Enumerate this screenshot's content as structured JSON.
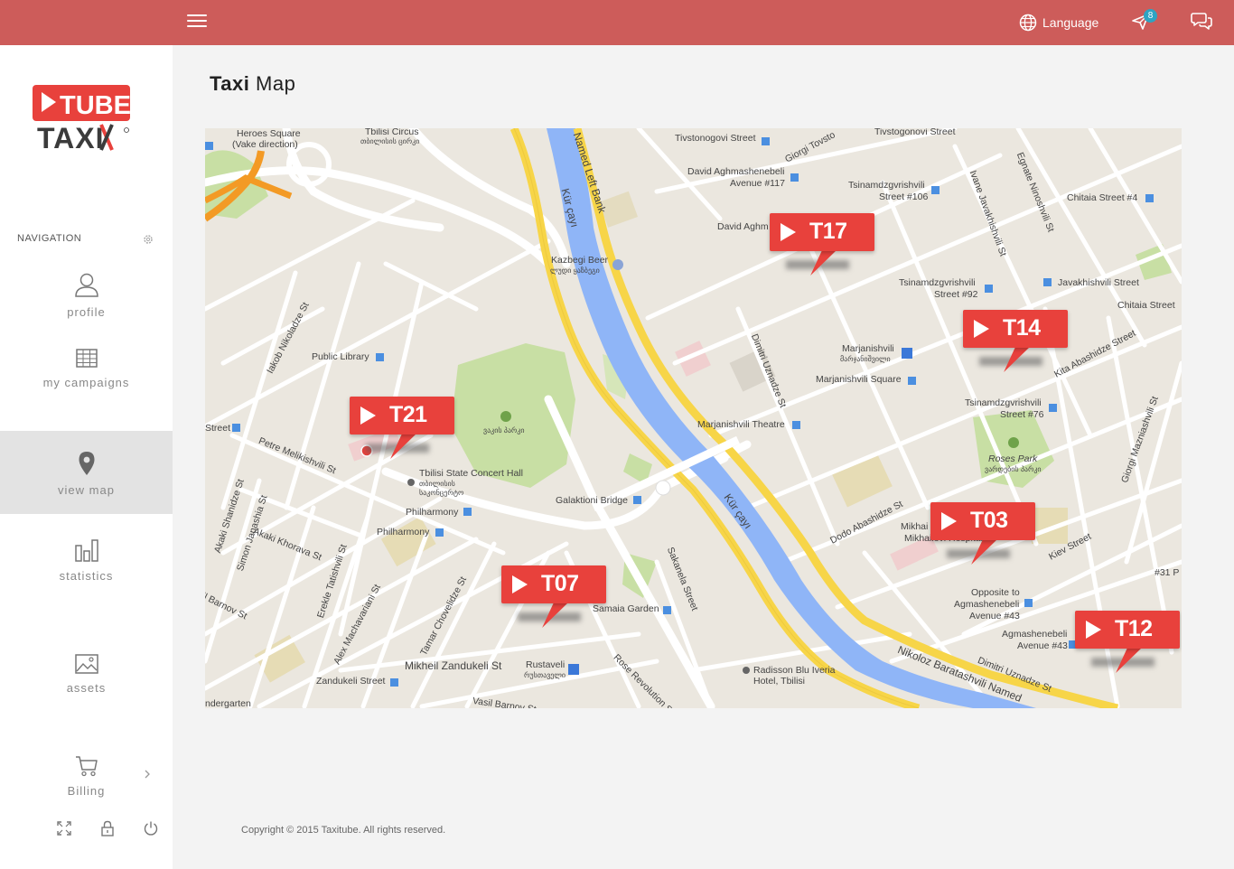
{
  "topbar": {
    "language_label": "Language",
    "notification_count": "8"
  },
  "sidebar": {
    "nav_title": "NAVIGATION",
    "items": [
      {
        "label": "profile",
        "icon": "user-icon"
      },
      {
        "label": "my campaigns",
        "icon": "table-icon"
      },
      {
        "label": "view map",
        "icon": "map-pin-icon",
        "active": true
      },
      {
        "label": "statistics",
        "icon": "bar-chart-icon"
      },
      {
        "label": "assets",
        "icon": "image-icon"
      },
      {
        "label": "Billing",
        "icon": "cart-icon"
      }
    ],
    "bottom_icons": [
      "fullscreen-icon",
      "lock-icon",
      "power-icon"
    ]
  },
  "logo": {
    "line1": "TUBE",
    "line2": "TAXI"
  },
  "page": {
    "title_bold": "Taxi",
    "title_rest": " Map"
  },
  "map": {
    "labels": {
      "heroes_square": "Heroes Square",
      "vake_direction": "(Vake direction)",
      "tbilisi_circus": "Tbilisi Circus",
      "tbilisi_circus_geo": "თბილისის ცირკი",
      "named_left_bank": "Named Left Bank",
      "kur_cayi_1": "Kür çayı",
      "kur_cayi_2": "Kür çayı",
      "tivstonogovi": "Tivstonogovi Street",
      "giorgi_tovst": "Giorgi Tovsto",
      "tivstogonovi": "Tivstogonovi Street",
      "david_agm_117a": "David Aghmashenebeli",
      "david_agm_117b": "Avenue #117",
      "tsinam_106a": "Tsinamdzgvrishvili",
      "tsinam_106b": "Street #106",
      "chitaia_4": "Chitaia Street #4",
      "david_agm_short": "David Aghm",
      "ivane_java": "Ivane Javakhishvili St",
      "egnate_nino": "Egnate Ninoshvili St",
      "kazbegi_beer": "Kazbegi Beer",
      "kazbegi_beer_geo": "ლუდი ყაზბეგი",
      "tsinam_92a": "Tsinamdzgvrishvili",
      "tsinam_92b": "Street #92",
      "javakh_street": "Javakhishvili Street",
      "chitaia_street": "Chitaia Street",
      "iakob_nikol": "Iakob Nikoladze St",
      "public_library": "Public Library",
      "dimitri_uz_1": "Dimitri Uznadze St",
      "marjanishvili": "Marjanishvili",
      "marjanishvili_geo": "მარჯანიშვილი",
      "marjanishvili_sq": "Marjanishvili Square",
      "kita_abash": "Kita Abashidze Street",
      "tsinam_76a": "Tsinamdzgvrishvili",
      "tsinam_76b": "Street #76",
      "street_left": "Street",
      "petre_mel": "Petre Melikishvili St",
      "marj_theatre": "Marjanishvili Theatre",
      "roses_park": "Roses Park",
      "roses_park_geo": "ვარდების პარკი",
      "giorgi_mazn": "Giorgi Mazniashvili St",
      "park_geo": "ვაკის პარკი",
      "concert_hall": "Tbilisi State Concert Hall",
      "concert_hall_geo1": "თბილისის",
      "concert_hall_geo2": "საკონცერტო",
      "akaki_shan": "Akaki Shanidze St",
      "simon_jan": "Simon Janashia St",
      "akaki_khor": "Akaki Khorava St",
      "philharmony_1": "Philharmony",
      "philharmony_2": "Philharmony",
      "galaktioni": "Galaktioni Bridge",
      "dodo_abash": "Dodo Abashidze St",
      "mikhai": "Mikhai",
      "mikhai_hosp": "Mikhailovi Hospital",
      "kiev_street": "Kiev Street",
      "erekle_tat": "Erekle Tatishvili St",
      "akhv_abas": "Alex Machavariani St",
      "tamar_chov": "Tamar Chovelidze St",
      "sakanela": "Sakanela Street",
      "samaia": "Samaia Garden",
      "opposite_a": "Opposite to",
      "opposite_b": "Agmashenebeli",
      "opposite_c": "Avenue #43",
      "agm_43a": "Agmashenebeli",
      "agm_43b": "Avenue #43",
      "num_31": "#31 P",
      "il_barnov": "il Barnov St",
      "mikheil_zand": "Mikheil Zandukeli St",
      "rustaveli": "Rustaveli",
      "rustaveli_geo": "რუსთაველი",
      "rose_revol": "Rose Revolution Sq",
      "radisson_a": "Radisson Blu Iveria",
      "radisson_b": "Hotel, Tbilisi",
      "nikoloz_bar": "Nikoloz Baratashvili Named",
      "dimitri_uz_2": "Dimitri Uznadze St",
      "zandukeli_st": "Zandukeli Street",
      "kindergarten": "ndergarten",
      "vasil_barnov": "Vasil Barnov St",
      "m_letter": "M"
    },
    "markers": [
      {
        "code": "T17"
      },
      {
        "code": "T14"
      },
      {
        "code": "T21"
      },
      {
        "code": "T03"
      },
      {
        "code": "T07"
      },
      {
        "code": "T12"
      }
    ]
  },
  "footer": {
    "copyright": "Copyright © 2015 Taxitube. All rights reserved."
  },
  "colors": {
    "topbar": "#cd5c5a",
    "marker": "#e8413c",
    "river": "#8fb5f7",
    "highway": "#f7d548",
    "park": "#c8dfa4",
    "badge": "#2ea4c2"
  }
}
